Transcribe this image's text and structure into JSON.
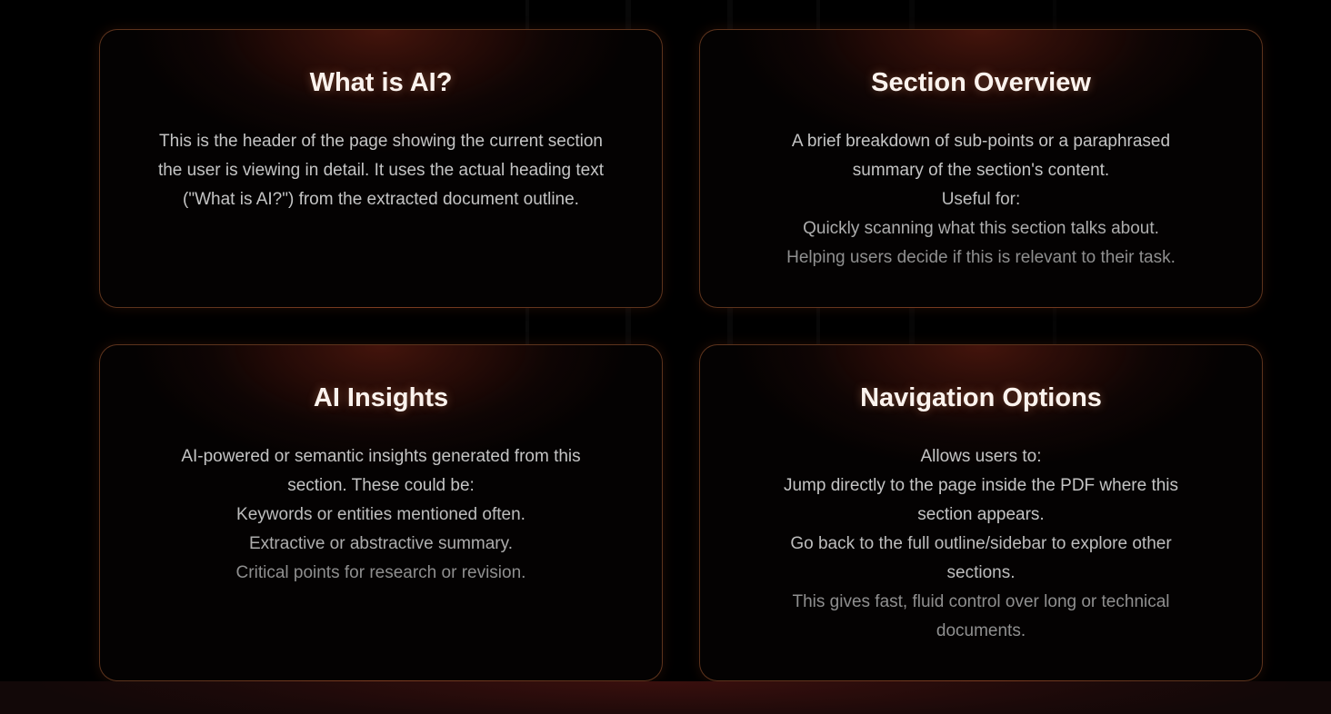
{
  "cards": [
    {
      "title": "What is AI?",
      "lines": [
        "This is the header of the page showing the current section",
        "the user is viewing in detail. It uses the actual heading text",
        "(\"What is AI?\") from the extracted document outline."
      ]
    },
    {
      "title": "Section Overview",
      "lines": [
        "A brief breakdown of sub-points or a paraphrased",
        "summary of the section's content.",
        "Useful for:",
        "Quickly scanning what this section talks about.",
        "Helping users decide if this is relevant to their task."
      ]
    },
    {
      "title": "AI Insights",
      "lines": [
        "AI-powered or semantic insights generated from this",
        "section. These could be:",
        "Keywords or entities mentioned often.",
        "Extractive or abstractive summary.",
        "Critical points for research or revision."
      ]
    },
    {
      "title": "Navigation Options",
      "lines": [
        "Allows users to:",
        "Jump directly to the page inside the PDF where this",
        "section appears.",
        "Go back to the full outline/sidebar to explore other",
        "sections.",
        "This gives fast, fluid control over long or technical",
        "documents."
      ]
    }
  ],
  "colors": {
    "background": "#000000",
    "card_border": "#c86e3c",
    "title": "#fbf3ee",
    "body_text": "#c4c4c4"
  }
}
